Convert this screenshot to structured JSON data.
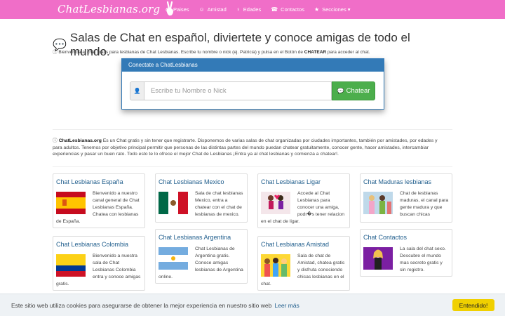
{
  "brand": {
    "name": "ChatLesbianas.org"
  },
  "nav": {
    "items": [
      {
        "icon": "globe-icon",
        "glyph": "◍",
        "label": "Paises"
      },
      {
        "icon": "smile-icon",
        "glyph": "☺",
        "label": "Amistad"
      },
      {
        "icon": "person-icon",
        "glyph": "♀",
        "label": "Edades"
      },
      {
        "icon": "phone-icon",
        "glyph": "☎",
        "label": "Contactos"
      },
      {
        "icon": "star-icon",
        "glyph": "★",
        "label": "Secciones ▾"
      }
    ]
  },
  "main": {
    "title": "Salas de Chat en español, diviertete y conoce amigas de todo el mundo.",
    "intro_text": "Bienvenida al chat gratis para lesbianas de Chat Lesbianas. Escribe tu nombre o nick (ej. Patricia) y pulsa en el Botón de ",
    "intro_strong": "CHATEAR",
    "intro_end": " para acceder al chat."
  },
  "connect": {
    "header": "Conectate a ChatLesbianas",
    "placeholder": "Escribe tu Nombre o Nick",
    "button": "Chatear"
  },
  "about": {
    "strong": "ChatLesbianas.org",
    "text": " Es un Chat gratis y sin tener que registrarte. Disponemos de varias salas de chat organizadas por ciudades importantes, también por amistades, por edades y para adultos. Tenemos por objetivo principal permitir que personas de las distintas partes del mundo puedan chatear gratuitamente, conocer gente, hacer amistades, intercambiar experiencias y pasar un buen rato. Todo esto te lo ofrece el mejor Chat de Lesbianas ¡Entra ya al chat lesbianas y comienza a chatear!."
  },
  "cards": [
    {
      "title": "Chat Lesbianas España",
      "text": "Bienvenido a nuestro canal general de Chat Lesbianas España. Chatea con lesbianas de España."
    },
    {
      "title": "Chat Lesbianas Mexico",
      "text": "Sala de chat lesbianas Mexico, entra a chatear con el chat de lesbianas de mexico."
    },
    {
      "title": "Chat Lesbianas Ligar",
      "text": "Accede al Chat Lesbianas para conocer una amiga, podr�s tener relacion en el chat de ligar."
    },
    {
      "title": "Chat Maduras lesbianas",
      "text": "Chat de lesbianas maduras, el canal para gente madura y que buscan chicas"
    },
    {
      "title": "Chat Lesbianas Colombia",
      "text": "Bienvenido a nuestra sala de Chat Lesbianas Colombia entra y conoce amigas gratis."
    },
    {
      "title": "Chat Lesbianas Argentina",
      "text": "Chat Lesbianas de Argentina gratis. Conoce amigas lesbianas de Argentina online."
    },
    {
      "title": "Chat Lesbianas Amistad",
      "text": "Sala de chat de Amistad, chatea gratis y disfruta conociendo chicas lesbianas en el chat."
    },
    {
      "title": "Chat Contactos",
      "text": "La sala del chat sexo. Descubre el mundo mas secreto gratis y sin registro."
    }
  ],
  "cookie": {
    "text": "Este sitio web utiliza cookies para asegurarse de obtener la mejor experiencia en nuestro sitio web",
    "link": "Leer más",
    "button": "Entendido!"
  }
}
